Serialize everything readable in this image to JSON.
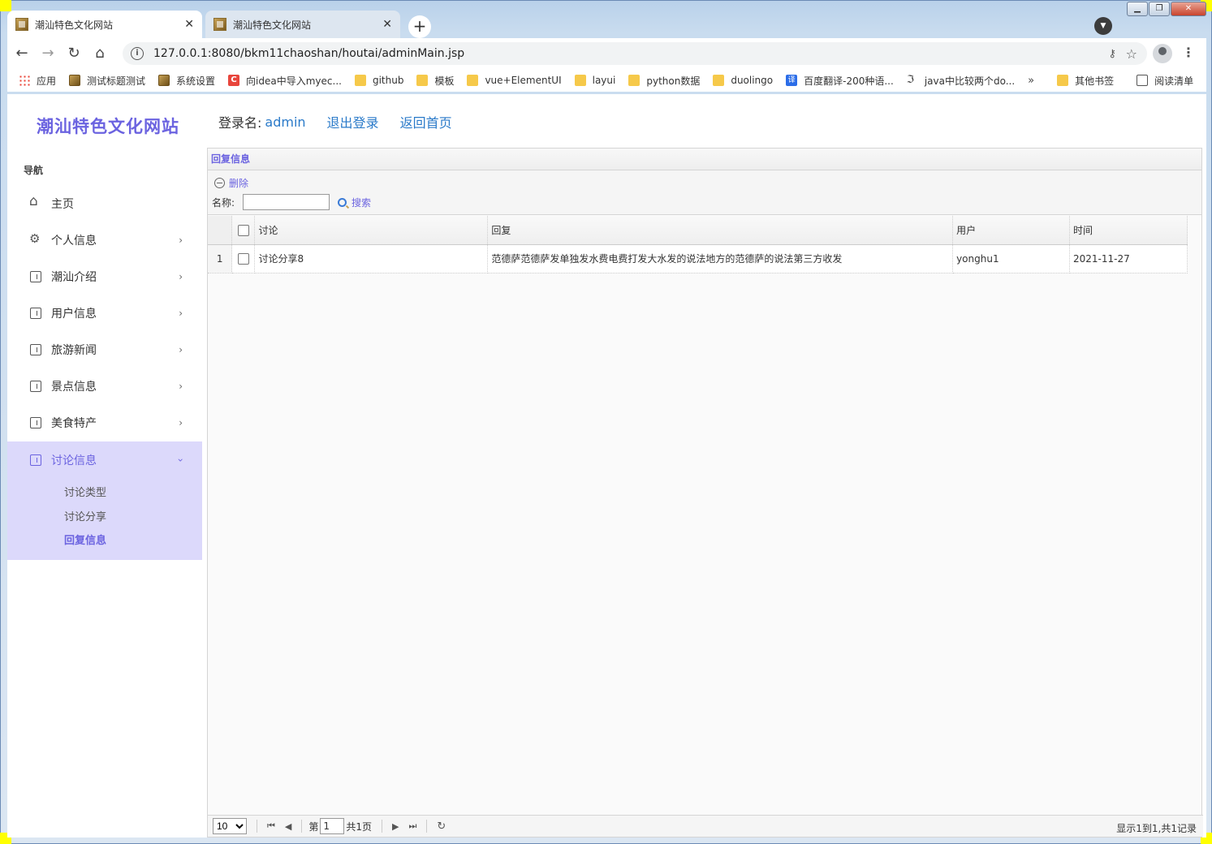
{
  "browser": {
    "tabs": [
      {
        "title": "潮汕特色文化网站",
        "active": true
      },
      {
        "title": "潮汕特色文化网站",
        "active": false
      }
    ],
    "url": "127.0.0.1:8080/bkm11chaoshan/houtai/adminMain.jsp",
    "bookmarks": [
      {
        "label": "应用",
        "icon": "apps-icon"
      },
      {
        "label": "测试标题测试",
        "icon": "site-icon"
      },
      {
        "label": "系统设置",
        "icon": "site-icon"
      },
      {
        "label": "向idea中导入myec...",
        "icon": "c-icon"
      },
      {
        "label": "github",
        "icon": "folder-icon"
      },
      {
        "label": "模板",
        "icon": "folder-icon"
      },
      {
        "label": "vue+ElementUI",
        "icon": "folder-icon"
      },
      {
        "label": "layui",
        "icon": "folder-icon"
      },
      {
        "label": "python数据",
        "icon": "folder-icon"
      },
      {
        "label": "duolingo",
        "icon": "folder-icon"
      },
      {
        "label": "百度翻译-200种语...",
        "icon": "translate-icon"
      },
      {
        "label": "java中比较两个do...",
        "icon": "j-icon"
      }
    ],
    "bookmarks_more": "»",
    "other_bookmarks": "其他书签",
    "reading_list": "阅读清单"
  },
  "sidebar": {
    "site_title": "潮汕特色文化网站",
    "nav_heading": "导航",
    "items": [
      {
        "label": "主页",
        "icon": "home-icon",
        "has_arrow": false
      },
      {
        "label": "个人信息",
        "icon": "gear-icon",
        "has_arrow": true
      },
      {
        "label": "潮汕介绍",
        "icon": "building-icon",
        "has_arrow": true
      },
      {
        "label": "用户信息",
        "icon": "building-icon",
        "has_arrow": true
      },
      {
        "label": "旅游新闻",
        "icon": "building-icon",
        "has_arrow": true
      },
      {
        "label": "景点信息",
        "icon": "building-icon",
        "has_arrow": true
      },
      {
        "label": "美食特产",
        "icon": "building-icon",
        "has_arrow": true
      }
    ],
    "open_item": {
      "label": "讨论信息",
      "icon": "building-icon",
      "sub_items": [
        {
          "label": "讨论类型",
          "active": false
        },
        {
          "label": "讨论分享",
          "active": false
        },
        {
          "label": "回复信息",
          "active": true
        }
      ]
    }
  },
  "header": {
    "login_label": "登录名:",
    "login_user": "admin",
    "logout": "退出登录",
    "home": "返回首页"
  },
  "panel": {
    "title": "回复信息",
    "delete_label": "删除",
    "search_label": "名称:",
    "search_value": "",
    "search_button": "搜索",
    "columns": [
      "讨论",
      "回复",
      "用户",
      "时间"
    ],
    "rows": [
      {
        "num": "1",
        "discussion": "讨论分享8",
        "reply": "范德萨范德萨发单独发水费电费打发大水发的说法地方的范德萨的说法第三方收发",
        "user": "yonghu1",
        "time": "2021-11-27"
      }
    ],
    "pager": {
      "page_size": "10",
      "page_prefix": "第",
      "page_value": "1",
      "page_suffix": "共1页",
      "info": "显示1到1,共1记录"
    }
  },
  "colors": {
    "accent": "#6b63e0",
    "link": "#2a7ac9",
    "open_menu_bg": "#dcd9fb"
  }
}
